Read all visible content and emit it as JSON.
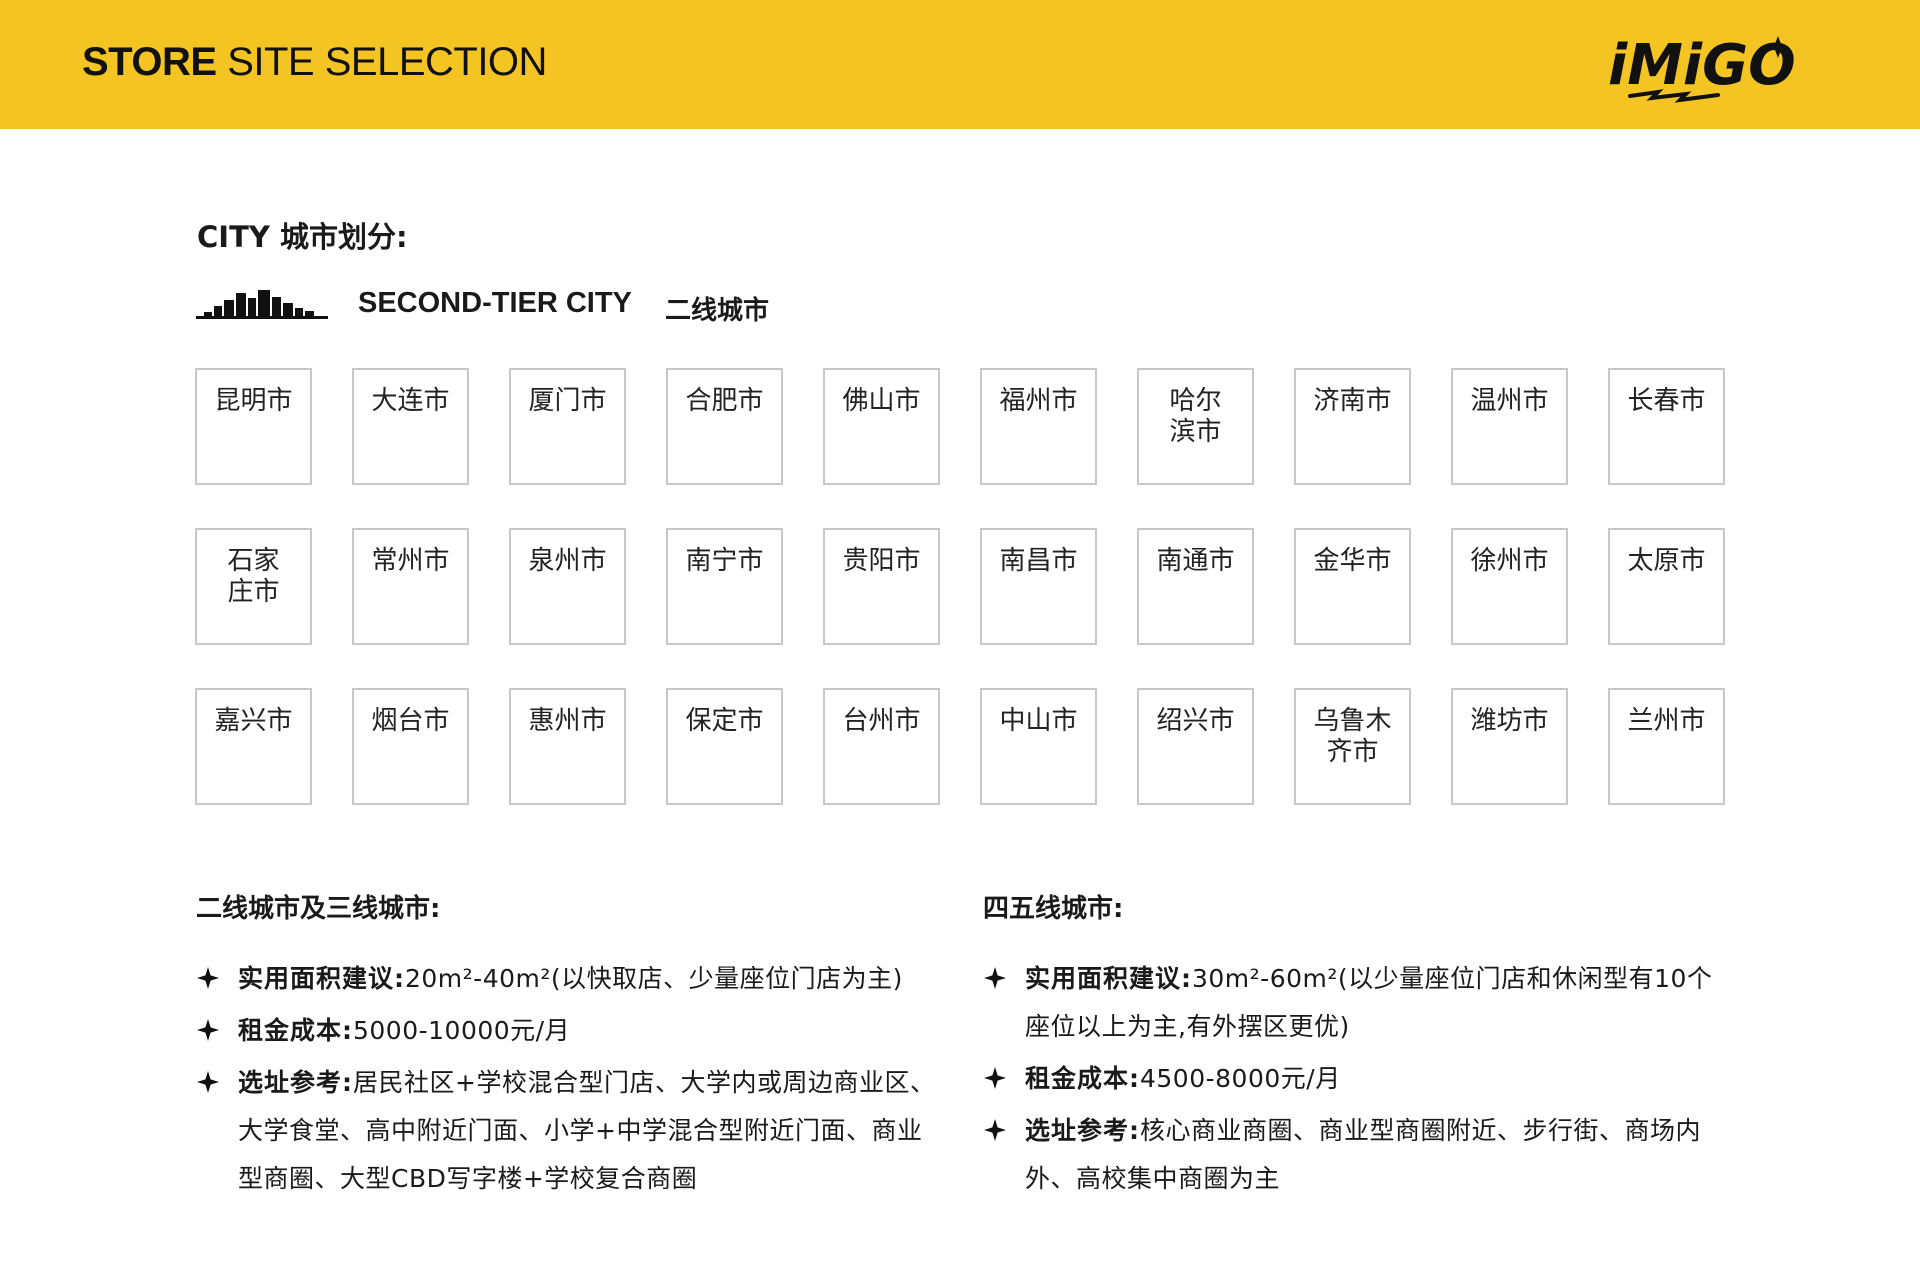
{
  "header": {
    "title_bold": "STORE",
    "title_light": " SITE SELECTION",
    "logo_text": "iMiGO",
    "bg_color": "#f4c522"
  },
  "section": {
    "title": "CITY 城市划分:"
  },
  "tier": {
    "icon": "city-skyline-icon",
    "title": "SECOND-TIER CITY",
    "subtitle": "二线城市"
  },
  "cities": [
    "昆明市",
    "大连市",
    "厦门市",
    "合肥市",
    "佛山市",
    "福州市",
    "哈尔滨市",
    "济南市",
    "温州市",
    "长春市",
    "石家庄市",
    "常州市",
    "泉州市",
    "南宁市",
    "贵阳市",
    "南昌市",
    "南通市",
    "金华市",
    "徐州市",
    "太原市",
    "嘉兴市",
    "烟台市",
    "惠州市",
    "保定市",
    "台州市",
    "中山市",
    "绍兴市",
    "乌鲁木齐市",
    "潍坊市",
    "兰州市"
  ],
  "left_column": {
    "heading": "二线城市及三线城市:",
    "items": [
      {
        "label": "实用面积建议:",
        "text": "20m²-40m²(以快取店、少量座位门店为主)"
      },
      {
        "label": "租金成本:",
        "text": "5000-10000元/月"
      },
      {
        "label": "选址参考:",
        "text": "居民社区+学校混合型门店、大学内或周边商业区、大学食堂、高中附近门面、小学+中学混合型附近门面、商业型商圈、大型CBD写字楼+学校复合商圈"
      }
    ]
  },
  "right_column": {
    "heading": "四五线城市:",
    "items": [
      {
        "label": "实用面积建议:",
        "text": "30m²-60m²(以少量座位门店和休闲型有10个座位以上为主,有外摆区更优)"
      },
      {
        "label": "租金成本:",
        "text": "4500-8000元/月"
      },
      {
        "label": "选址参考:",
        "text": "核心商业商圈、商业型商圈附近、步行街、商场内外、高校集中商圈为主"
      }
    ]
  },
  "icons": {
    "bullet": "four-point-star-icon"
  }
}
